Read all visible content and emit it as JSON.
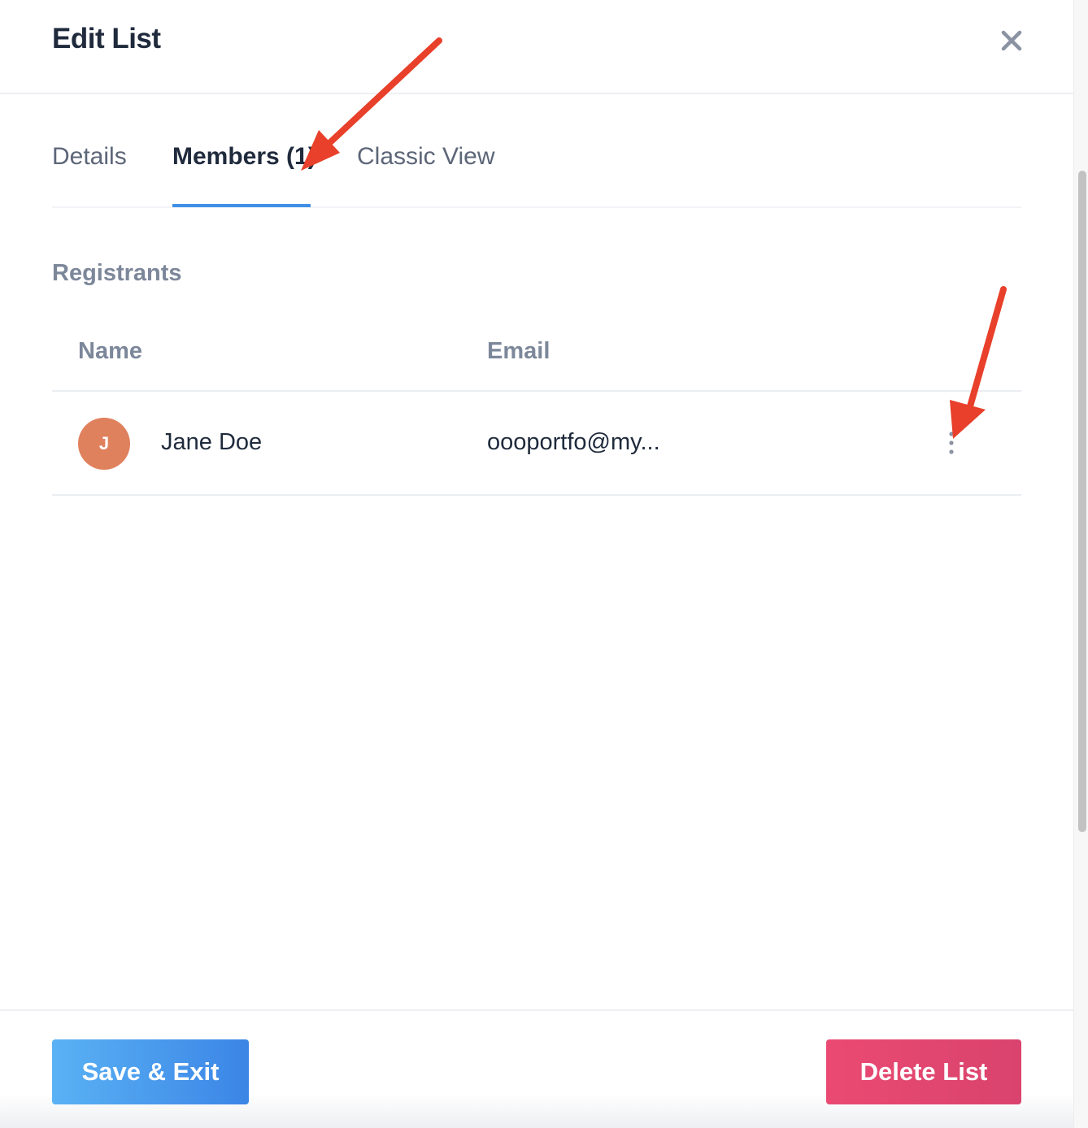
{
  "header": {
    "title": "Edit List",
    "close_icon": "close-icon"
  },
  "tabs": [
    {
      "label": "Details",
      "active": false
    },
    {
      "label": "Members (1)",
      "active": true
    },
    {
      "label": "Classic View",
      "active": false
    }
  ],
  "section": {
    "title": "Registrants"
  },
  "table": {
    "columns": [
      "Name",
      "Email"
    ],
    "rows": [
      {
        "avatar_initial": "J",
        "name": "Jane Doe",
        "email": "oooportfo@my...",
        "menu_icon": "more-vertical-icon"
      }
    ]
  },
  "footer": {
    "save_label": "Save & Exit",
    "delete_label": "Delete List"
  },
  "colors": {
    "accent": "#3f8fe6",
    "danger": "#e5466f",
    "avatar": "#e0815e",
    "annotation_arrow": "#e8402a"
  }
}
